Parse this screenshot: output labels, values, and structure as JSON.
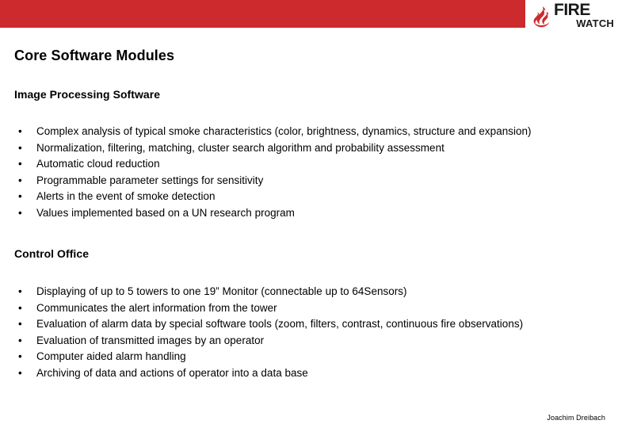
{
  "header": {
    "bar_color": "#cc2a2d",
    "logo": {
      "flame_icon": "flame-icon",
      "line1": "FIRE",
      "line2": "WATCH"
    }
  },
  "slide": {
    "title": "Core Software Modules",
    "sections": [
      {
        "heading": "Image Processing Software",
        "bullets": [
          "Complex analysis of typical smoke characteristics (color, brightness, dynamics, structure and expansion)",
          "Normalization, filtering, matching, cluster search algorithm and probability assessment",
          "Automatic cloud reduction",
          "Programmable parameter settings for sensitivity",
          "Alerts in the event of smoke detection",
          "Values implemented based on a UN research program"
        ]
      },
      {
        "heading": "Control Office",
        "bullets": [
          "Displaying of up to 5 towers to one 19” Monitor (connectable up to 64Sensors)",
          "Communicates the alert information from the tower",
          "Evaluation of alarm data by special software tools (zoom, filters, contrast, continuous fire observations)",
          "Evaluation of transmitted images by an operator",
          "Computer aided alarm handling",
          "Archiving of data and actions of operator into a data base"
        ]
      }
    ],
    "bullet_marker": "•"
  },
  "footer": {
    "author": "Joachim Dreibach"
  }
}
